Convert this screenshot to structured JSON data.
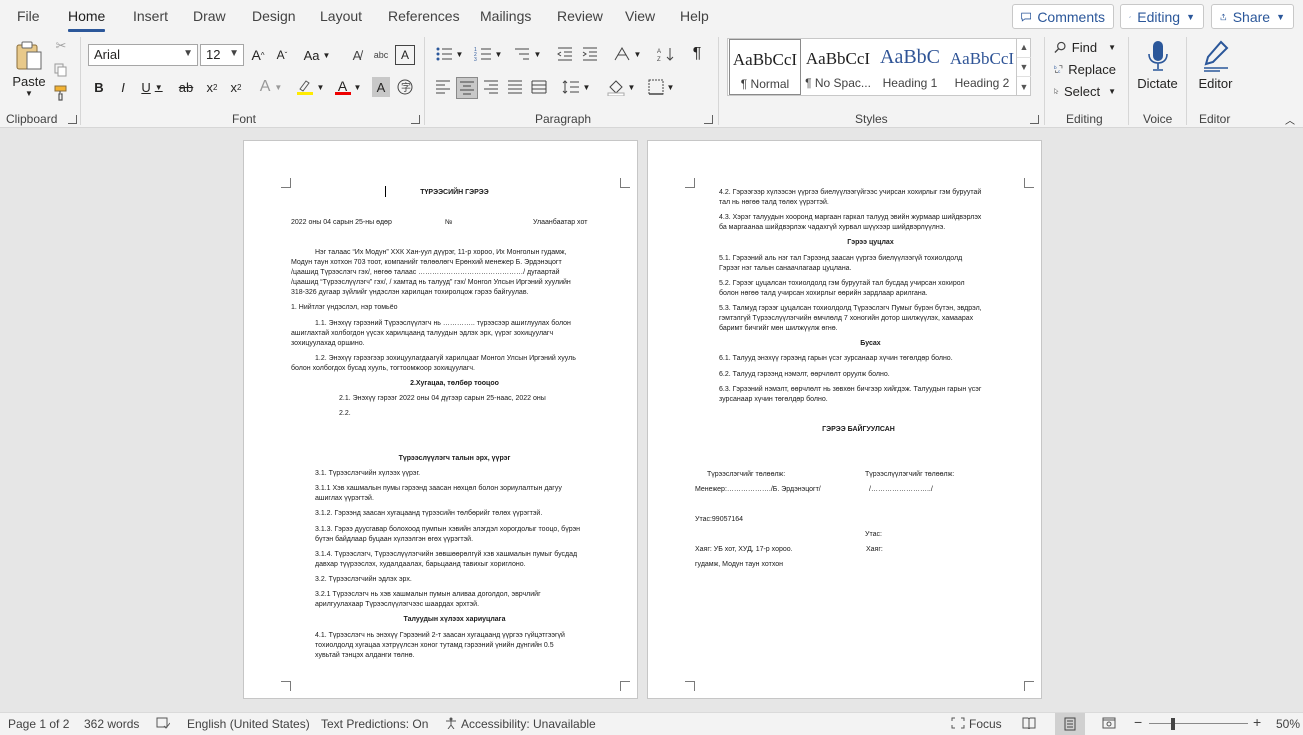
{
  "menu": {
    "tabs": [
      "File",
      "Home",
      "Insert",
      "Draw",
      "Design",
      "Layout",
      "References",
      "Mailings",
      "Review",
      "View",
      "Help"
    ],
    "comments": "Comments",
    "editing": "Editing",
    "share": "Share"
  },
  "ribbon": {
    "clipboard": {
      "paste": "Paste",
      "label": "Clipboard"
    },
    "font": {
      "name": "Arial",
      "size": "12",
      "label": "Font",
      "case_label": "Aa"
    },
    "paragraph": {
      "label": "Paragraph"
    },
    "styles": {
      "label": "Styles",
      "items": [
        {
          "sample": "AaBbCcI",
          "name": "¶ Normal"
        },
        {
          "sample": "AaBbCcI",
          "name": "¶ No Spac..."
        },
        {
          "sample": "AaBbC",
          "name": "Heading 1"
        },
        {
          "sample": "AaBbCcI",
          "name": "Heading 2"
        }
      ]
    },
    "editing": {
      "label": "Editing",
      "find": "Find",
      "replace": "Replace",
      "select": "Select"
    },
    "voice": {
      "dictate": "Dictate",
      "label": "Voice"
    },
    "editor": {
      "editor": "Editor",
      "label": "Editor"
    }
  },
  "page1": {
    "title": "ТҮРЭЭСИЙН ГЭРЭЭ",
    "date": "2022 оны 04 сарын 25-ны өдөр",
    "number": "№",
    "city": "Улаанбаатар хот",
    "intro": [
      "Нэг талаас “Их Модун” ХХК Хан-уул дүүрэг, 11-р хороо, Их Монголын гудамж,",
      "Модун таун хотхон 703 тоот, компанийг төлөөлөгч Ерөнхий менежер Б. Эрдэнэцогт",
      "/цаашид Түрээслэгч гэх/, нөгөө талаас ………………………………………/ дугаартай",
      "/цаашид “Түрээслүүлэгч” гэх/, / хамтад нь талууд” гэх/ Монгол Улсын Иргэний хуулийн",
      "318-326 дугаар зүйлийг үндэслэн харилцан тохиролцож гэрээ байгуулав."
    ],
    "s1": "1. Нийтлэг үндэслэл, нэр томьёо",
    "s1_1": [
      "1.1. Энэхүү гэрээний Түрээслүүлэгч нь ………….. түрээсээр ашиглуулах болон",
      "ашиглахтай холбогдон үүсэх харилцаанд талуудын эдлэх эрх, үүрэг зохицуулагч",
      "зохицуулахад оршино."
    ],
    "s1_2": [
      "1.2. Энэхүү гэрээгээр зохицуулагдаагүй харилцааг Монгол Улсын Иргэний хууль",
      "болон холбогдох бусад хууль, тогтоомжоор зохицуулагч."
    ],
    "h2": "2.Хугацаа, төлбөр тооцоо",
    "s2_1": "2.1. Энэхүү гэрээг 2022 оны 04 дүгээр сарын 25-наас, 2022 оны",
    "s2_2": "2.2.",
    "h3": "Түрээслүүлэгч талын эрх, үүрэг",
    "s3_1": "3.1. Түрээслэгчийн хүлээх үүрэг.",
    "s3_1_1": [
      "3.1.1 Хэв хашмалын пумы гэрээнд заасан нөхцөл болон зориулалтын дагуу",
      "ашиглах үүрэгтэй."
    ],
    "s3_1_2": "3.1.2. Гэрээнд заасан хугацаанд түрээсийн төлбөрийг төлөх үүрэгтэй.",
    "s3_1_3": [
      "3.1.3. Гэрээ дуусгавар болохоод пумпын хэвийн элэгдэл хорогдолыг тооцо, бүрэн",
      "бүтэн байдлаар буцаан хүлээлгэн өгөх үүрэгтэй."
    ],
    "s3_1_4": [
      "3.1.4. Түрээслэгч, Түрээслүүлэгчийн зөвшөөрөлгүй хэв хашмалын пумыг бусдад",
      "давхар түүрээслэх, худалдаалах, барьцаанд тавихыг хориглоно."
    ],
    "s3_2": "3.2. Түрээслэгчийн эдлэх эрх.",
    "s3_2_1": [
      "3.2.1 Түрээслэгч нь хэв хашмалын пумын аливаа доголдол, эврчлийг",
      "арилгуулахаар Түрээслүүлэгчээс шаардах эрхтэй."
    ],
    "h4": "Талуудын хүлээх хариуцлага",
    "s4_1": [
      "4.1. Түрээслэгч нь энэхүү Гэрээний 2-т заасан хугацаанд үүргээ гүйцэтгээгүй",
      "тохиолдолд хугацаа хэтрүүлсэн хоног тутамд гэрээний үнийн дүнгийн 0.5",
      "хувьтай тэнцэх алданги төлнө."
    ]
  },
  "page2": {
    "s4_2": [
      "4.2. Гэрээгээр хүлээсэн үүргээ биелүүлээгүйгээс учирсан хохирлыг гэм буруутай",
      "тал нь нөгөө талд төлөх үүрэгтэй."
    ],
    "s4_3": [
      "4.3. Хэрэг талуудын хооронд маргаан гаркал талууд эвийн журмаар шийдвэрлэх",
      "ба маргаанаа шийдвэрлэж чадахгүй хурвал шүүхээр шийдвэрлүүлнэ."
    ],
    "h5": "Гэрээ цуцлах",
    "s5_1": [
      "5.1. Гэрээний аль нэг тал Гэрээнд заасан үүргээ биелүүлээгүй тохиолдолд",
      "Гэрээг нэг талын санаачлагаар цуцлана."
    ],
    "s5_2": [
      "5.2. Гэрээг цуцалсан тохиолдолд гэм буруутай тал бусдад учирсан хохирол",
      "болон нөгөө талд учирсан хохирлыг өөрийн зардлаар арилгана."
    ],
    "s5_3": [
      "5.3. Талмуд гэрээг цуцалсан тохиолдолд Түрээслэгч Пумыг бүрэн бүтэн, эвдрэл,",
      "гэмтэлгүй Түрээслүүлэгчийн өмчлөлд 7 хоногийн дотор шилжүүлэх, хамаарах",
      "баримт бичгийг мөн шилжүүлж өгнө."
    ],
    "h6": "Бусах",
    "s6_1": "6.1. Талууд энэхүү гэрээнд гарын үсэг зурсанаар хүчин төгөлдөр болно.",
    "s6_2": "6.2. Талууд гэрээнд нэмэлт, өөрчлөлт оруулж болно.",
    "s6_3": [
      "6.3. Гэрээний нэмэлт, өөрчлөлт нь зөвхөн бичгээр хийгдэж. Талуудын гарын үсэг",
      "зурсанаар хүчин төгөлдөр болно."
    ],
    "signed": "ГЭРЭЭ БАЙГУУЛСАН",
    "lessor_rep": "Түрээслэгчийг төлөөлж:",
    "lessee_rep": "Түрээслүүлэгчийг төлөөлж:",
    "manager": "Менежер:………………./Б. Эрдэнэцогт/",
    "lessee_sign": "/……………………../",
    "phone": "Утас:99057164",
    "phone2": "Утас:",
    "addr1": "Хаяг: УБ хот, ХУД, 17-р хороо.",
    "addr2": "гудамж, Модун таун хотхон",
    "addr3": "Хаяг:"
  },
  "status": {
    "page": "Page 1 of 2",
    "words": "362 words",
    "language": "English (United States)",
    "predictions": "Text Predictions: On",
    "accessibility": "Accessibility: Unavailable",
    "focus": "Focus",
    "zoom": "50%"
  }
}
